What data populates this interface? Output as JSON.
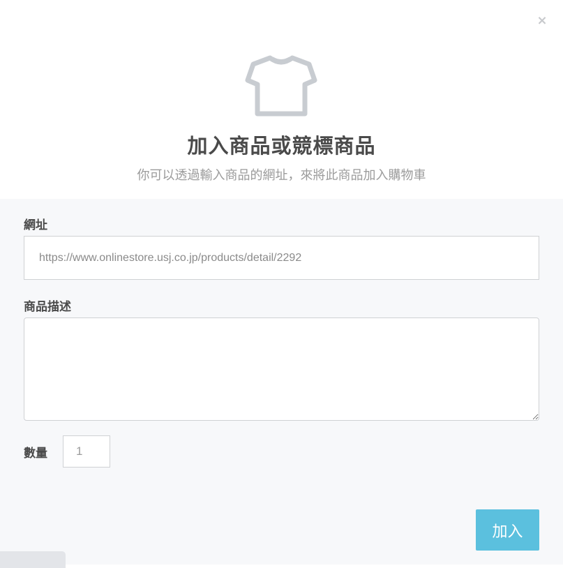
{
  "modal": {
    "close_symbol": "×",
    "icon": "t-shirt-icon",
    "title": "加入商品或競標商品",
    "subtitle": "你可以透過輸入商品的網址，來將此商品加入購物車"
  },
  "form": {
    "url": {
      "label": "網址",
      "value": "",
      "placeholder": "https://www.onlinestore.usj.co.jp/products/detail/2292"
    },
    "description": {
      "label": "商品描述",
      "value": "",
      "placeholder": ""
    },
    "quantity": {
      "label": "數量",
      "value": "",
      "placeholder": "1"
    },
    "submit_label": "加入"
  },
  "colors": {
    "accent": "#5bc0de",
    "icon_gray": "#c8ccd1",
    "form_background": "#f7f8fa"
  }
}
